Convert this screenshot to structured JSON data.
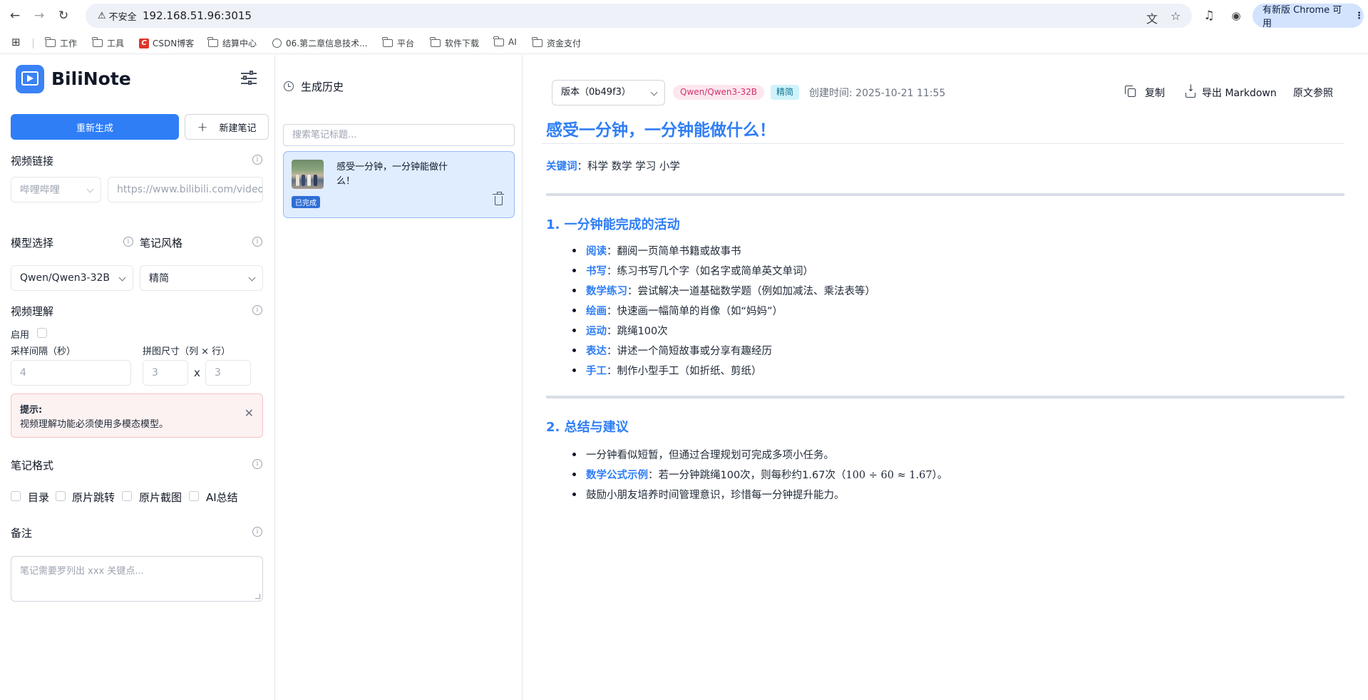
{
  "browser": {
    "security_label": "不安全",
    "url": "192.168.51.96:3015",
    "update_label": "有新版 Chrome 可用",
    "bookmarks": [
      "工作",
      "工具",
      "CSDN博客",
      "结算中心",
      "06.第二章信息技术...",
      "平台",
      "软件下载",
      "AI",
      "资金支付"
    ]
  },
  "sidebar": {
    "app_name": "BiliNote",
    "regenerate_label": "重新生成",
    "new_note_label": "新建笔记",
    "video_link_title": "视频链接",
    "platform_value": "哔哩哔哩",
    "url_placeholder": "https://www.bilibili.com/video/...",
    "model_title": "模型选择",
    "style_title": "笔记风格",
    "model_value": "Qwen/Qwen3-32B",
    "style_value": "精简",
    "video_understanding_title": "视频理解",
    "enable_label": "启用",
    "interval_label": "采样间隔（秒）",
    "interval_value": "4",
    "grid_label": "拼图尺寸（列 × 行）",
    "grid_cols": "3",
    "grid_x": "x",
    "grid_rows": "3",
    "hint_title": "提示:",
    "hint_text": "视频理解功能必须使用多模态模型。",
    "format_title": "笔记格式",
    "format_options": [
      "目录",
      "原片跳转",
      "原片截图",
      "AI总结"
    ],
    "remark_title": "备注",
    "remark_placeholder": "笔记需要罗列出 xxx 关键点..."
  },
  "history": {
    "title": "生成历史",
    "search_placeholder": "搜索笔记标题...",
    "items": [
      {
        "title": "感受一分钟，一分钟能做什么！",
        "status": "已完成"
      }
    ]
  },
  "note": {
    "version_label": "版本（0b49f3）",
    "model_badge": "Qwen/Qwen3-32B",
    "style_badge": "精简",
    "created": "创建时间: 2025-10-21 11:55",
    "copy_label": "复制",
    "export_label": "导出 Markdown",
    "source_label": "原文参照",
    "title": "感受一分钟，一分钟能做什么！",
    "keywords_label": "关键词",
    "keywords": "：科学 数学 学习 小学",
    "section1_title": "1. 一分钟能完成的活动",
    "section1_items": [
      {
        "key": "阅读",
        "text": "：翻阅一页简单书籍或故事书"
      },
      {
        "key": "书写",
        "text": "：练习书写几个字（如名字或简单英文单词）"
      },
      {
        "key": "数学练习",
        "text": "：尝试解决一道基础数学题（例如加减法、乘法表等）"
      },
      {
        "key": "绘画",
        "text": "：快速画一幅简单的肖像（如“妈妈”）"
      },
      {
        "key": "运动",
        "text": "：跳绳100次"
      },
      {
        "key": "表达",
        "text": "：讲述一个简短故事或分享有趣经历"
      },
      {
        "key": "手工",
        "text": "：制作小型手工（如折纸、剪纸）"
      }
    ],
    "section2_title": "2. 总结与建议",
    "section2_item1": "一分钟看似短暂，但通过合理规划可完成多项小任务。",
    "section2_item2_key": "数学公式示例",
    "section2_item2_text": "：若一分钟跳绳100次，则每秒约1.67次（",
    "section2_item2_math": "100 ÷ 60 ≈ 1.67",
    "section2_item2_end": "）。",
    "section2_item3": "鼓励小朋友培养时间管理意识，珍惜每一分钟提升能力。"
  }
}
